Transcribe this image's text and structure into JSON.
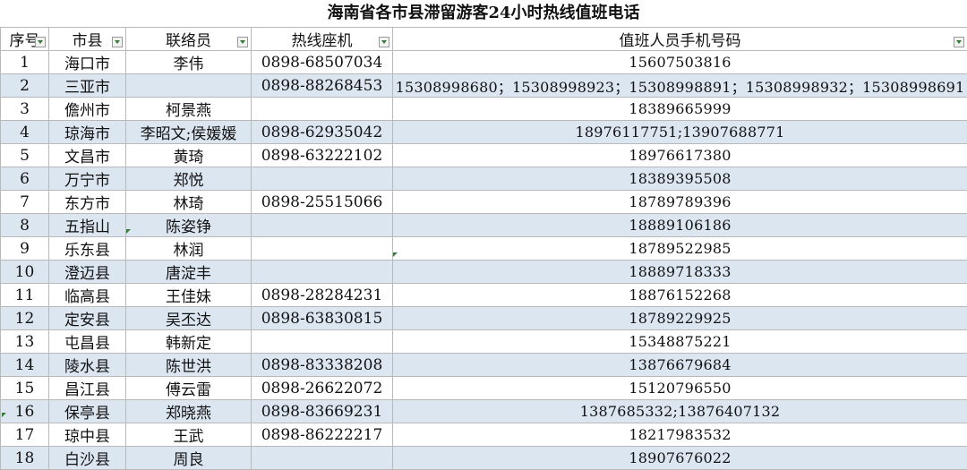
{
  "sheet": {
    "title": "海南省各市县滞留游客24小时热线值班电话",
    "headers": [
      "序号",
      "市县",
      "联络员",
      "热线座机",
      "值班人员手机号码"
    ],
    "rows": [
      {
        "no": "1",
        "city": "海口市",
        "contact": "李伟",
        "landline": "0898-68507034",
        "mobile": "15607503816"
      },
      {
        "no": "2",
        "city": "三亚市",
        "contact": "",
        "landline": "0898-88268453",
        "mobile": "15308998680；15308998923；15308998891；15308998932；15308998691"
      },
      {
        "no": "3",
        "city": "儋州市",
        "contact": "柯景燕",
        "landline": "",
        "mobile": "18389665999"
      },
      {
        "no": "4",
        "city": "琼海市",
        "contact": "李昭文;侯媛媛",
        "landline": "0898-62935042",
        "mobile": "18976117751;13907688771"
      },
      {
        "no": "5",
        "city": "文昌市",
        "contact": "黄琦",
        "landline": "0898-63222102",
        "mobile": "18976617380"
      },
      {
        "no": "6",
        "city": "万宁市",
        "contact": "郑悦",
        "landline": "",
        "mobile": "18389395508"
      },
      {
        "no": "7",
        "city": "东方市",
        "contact": "林琦",
        "landline": "0898-25515066",
        "mobile": "18789789396"
      },
      {
        "no": "8",
        "city": "五指山",
        "contact": "陈姿铮",
        "landline": "",
        "mobile": "18889106186"
      },
      {
        "no": "9",
        "city": "乐东县",
        "contact": "林润",
        "landline": "",
        "mobile": "18789522985"
      },
      {
        "no": "10",
        "city": "澄迈县",
        "contact": "唐淀丰",
        "landline": "",
        "mobile": "18889718333"
      },
      {
        "no": "11",
        "city": "临高县",
        "contact": "王佳妹",
        "landline": "0898-28284231",
        "mobile": "18876152268"
      },
      {
        "no": "12",
        "city": "定安县",
        "contact": "吴丕达",
        "landline": "0898-63830815",
        "mobile": "18789229925"
      },
      {
        "no": "13",
        "city": "屯昌县",
        "contact": "韩新定",
        "landline": "",
        "mobile": "15348875221"
      },
      {
        "no": "14",
        "city": "陵水县",
        "contact": "陈世洪",
        "landline": "0898-83338208",
        "mobile": "13876679684"
      },
      {
        "no": "15",
        "city": "昌江县",
        "contact": "傅云雷",
        "landline": "0898-26622072",
        "mobile": "15120796550"
      },
      {
        "no": "16",
        "city": "保亭县",
        "contact": "郑晓燕",
        "landline": "0898-83669231",
        "mobile": "1387685332;13876407132"
      },
      {
        "no": "17",
        "city": "琼中县",
        "contact": "王武",
        "landline": "0898-86222217",
        "mobile": "18217983532"
      },
      {
        "no": "18",
        "city": "白沙县",
        "contact": "周良",
        "landline": "",
        "mobile": "18907676022"
      }
    ],
    "colors": {
      "band": "#dce6f1",
      "grid": "#b9b9b9",
      "marker": "#2e7d32"
    }
  }
}
